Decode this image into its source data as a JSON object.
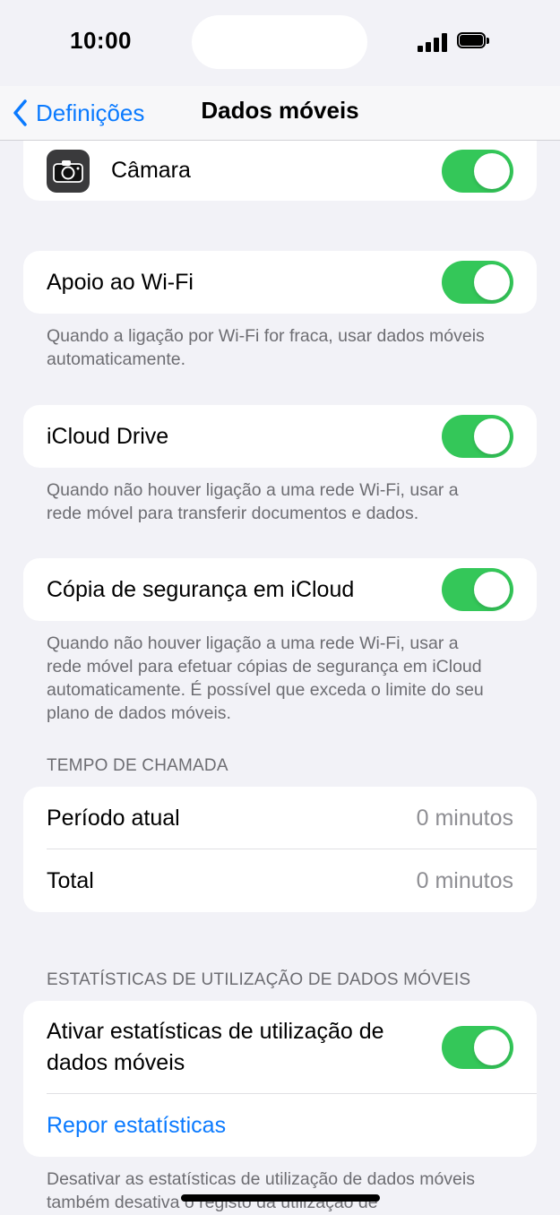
{
  "status": {
    "time": "10:00"
  },
  "nav": {
    "back_label": "Definições",
    "title": "Dados móveis"
  },
  "camera_row": {
    "label": "Câmara",
    "toggle_on": true
  },
  "wifi_assist": {
    "label": "Apoio ao Wi-Fi",
    "toggle_on": true,
    "footer": "Quando a ligação por Wi-Fi for fraca, usar dados móveis automaticamente."
  },
  "icloud_drive": {
    "label": "iCloud Drive",
    "toggle_on": true,
    "footer": "Quando não houver ligação a uma rede Wi-Fi, usar a rede móvel para transferir documentos e dados."
  },
  "icloud_backup": {
    "label": "Cópia de segurança em iCloud",
    "toggle_on": true,
    "footer": "Quando não houver ligação a uma rede Wi-Fi, usar a rede móvel para efetuar cópias de segurança em iCloud automaticamente. É possível que exceda o limite do seu plano de dados móveis."
  },
  "call_time": {
    "header": "TEMPO DE CHAMADA",
    "rows": [
      {
        "label": "Período atual",
        "value": "0 minutos"
      },
      {
        "label": "Total",
        "value": "0 minutos"
      }
    ]
  },
  "usage_stats": {
    "header": "ESTATÍSTICAS DE UTILIZAÇÃO DE DADOS MÓVEIS",
    "enable_label": "Ativar estatísticas de utilização de dados móveis",
    "toggle_on": true,
    "reset_label": "Repor estatísticas",
    "footer": "Desativar as estatísticas de utilização de dados móveis também desativa o registo da utilização de"
  },
  "colors": {
    "accent": "#0a7aff",
    "toggle_on": "#34c759",
    "background": "#f2f2f7"
  }
}
